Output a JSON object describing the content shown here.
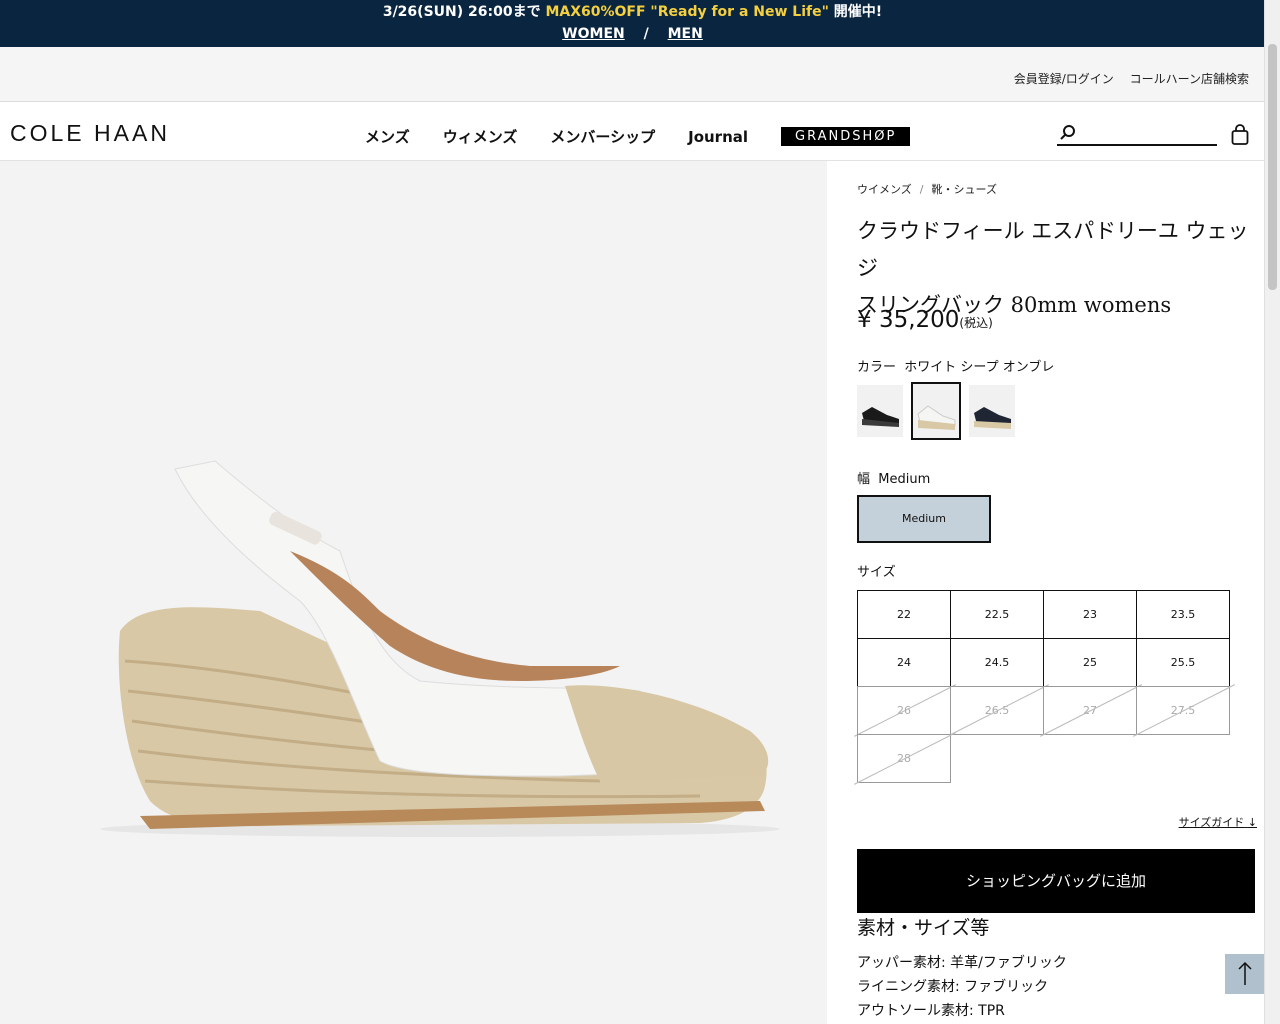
{
  "promo": {
    "date": "3/26(SUN) 26:00まで",
    "highlight": "MAX60%OFF \"Ready for a New Life\"",
    "suffix": "開催中!",
    "women": "WOMEN",
    "separator": "/",
    "men": "MEN"
  },
  "utility": {
    "register": "会員登録/ログイン",
    "stores": "コールハーン店舗検索"
  },
  "header": {
    "logo": "COLE HAAN",
    "nav": [
      "メンズ",
      "ウィメンズ",
      "メンバーシップ",
      "Journal"
    ],
    "grandshop": "GRANDSHØP"
  },
  "breadcrumb": {
    "first": "ウイメンズ",
    "separator": "/",
    "second": "靴・シューズ"
  },
  "product": {
    "title_line1": "クラウドフィール エスパドリーユ ウェッジ",
    "title_line2": "スリングバック 80mm womens",
    "price": "¥ 35,200",
    "tax": "(税込)",
    "color_label": "カラー",
    "color_value": "ホワイト シープ オンブレ",
    "width_label": "幅",
    "width_value": "Medium",
    "width_button": "Medium",
    "size_label": "サイズ",
    "sizes": [
      {
        "label": "22",
        "available": true
      },
      {
        "label": "22.5",
        "available": true
      },
      {
        "label": "23",
        "available": true
      },
      {
        "label": "23.5",
        "available": true
      },
      {
        "label": "24",
        "available": true
      },
      {
        "label": "24.5",
        "available": true
      },
      {
        "label": "25",
        "available": true
      },
      {
        "label": "25.5",
        "available": true
      },
      {
        "label": "26",
        "available": false
      },
      {
        "label": "26.5",
        "available": false
      },
      {
        "label": "27",
        "available": false
      },
      {
        "label": "27.5",
        "available": false
      },
      {
        "label": "28",
        "available": false
      }
    ],
    "size_guide": "サイズガイド",
    "add_to_bag": "ショッピングバッグに追加",
    "material_title": "素材・サイズ等",
    "materials": [
      "アッパー素材: 羊革/ファブリック",
      "ライニング素材: ファブリック",
      "アウトソール素材: TPR"
    ]
  },
  "icons": {
    "search": "search-icon",
    "bag": "shopping-bag-icon",
    "back_to_top": "arrow-up-icon"
  }
}
